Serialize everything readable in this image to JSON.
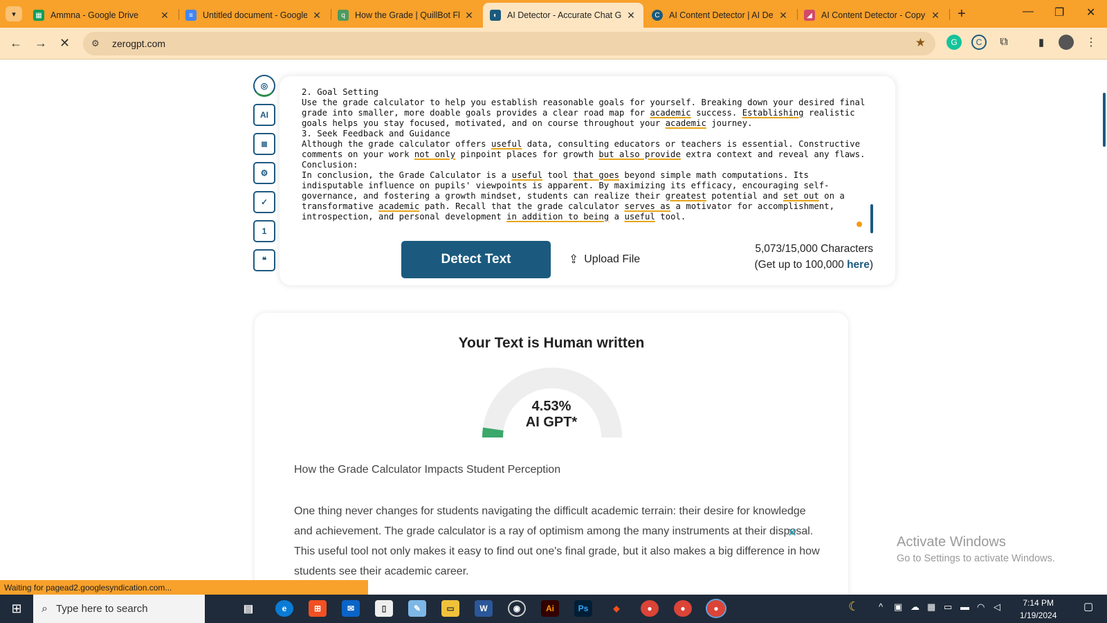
{
  "browser": {
    "tabs": [
      {
        "title": "Ammna - Google Drive",
        "icon": "sheets-icon",
        "color": "#0f9d58"
      },
      {
        "title": "Untitled document - Google",
        "icon": "docs-icon",
        "color": "#4285f4"
      },
      {
        "title": "How the Grade | QuillBot Flo",
        "icon": "quillbot-icon",
        "color": "#4c9a5f"
      },
      {
        "title": "AI Detector - Accurate Chat G",
        "icon": "zerogpt-icon",
        "color": "#1b5a7e"
      },
      {
        "title": "AI Content Detector | AI Dete",
        "icon": "copyleaks-icon",
        "color": "#1b5a7e"
      },
      {
        "title": "AI Content Detector - Copyle",
        "icon": "copyleaks-pink-icon",
        "color": "#d14a6a"
      }
    ],
    "url": "zerogpt.com",
    "status": "Waiting for pagead2.googlesyndication.com..."
  },
  "editor": {
    "lines": [
      "2. Goal Setting",
      "Use the grade calculator to help you establish reasonable goals for yourself. Breaking down your desired final",
      "grade into smaller, more doable goals provides a clear road map for academic success. Establishing realistic",
      "goals helps you stay focused, motivated, and on course throughout your academic journey.",
      "3. Seek Feedback and Guidance",
      "Although the grade calculator offers useful data, consulting educators or teachers is essential. Constructive",
      "comments on your work not only pinpoint places for growth but also provide extra context and reveal any flaws.",
      "Conclusion:",
      "In conclusion, the Grade Calculator is a useful tool that goes beyond simple math computations. Its",
      "indisputable influence on pupils' viewpoints is apparent. By maximizing its efficacy, encouraging self-",
      "governance, and fostering a growth mindset, students can realize their greatest potential and set out on a",
      "transformative academic path. Recall that the grade calculator serves as a motivator for accomplishment,",
      "introspection, and personal development in addition to being a useful tool."
    ],
    "underlined": [
      "Establishing",
      "academic",
      "useful",
      "not only",
      "but also provide",
      "that goes",
      "greatest",
      "set out",
      "serves as",
      "in addition to being"
    ],
    "detect_label": "Detect Text",
    "upload_label": "Upload File",
    "char_count": "5,073/15,000 Characters",
    "char_upsell_prefix": "(Get up to 100,000 ",
    "char_upsell_link": "here",
    "char_upsell_suffix": ")"
  },
  "result": {
    "heading": "Your Text is Human written",
    "percent": "4.53%",
    "percent_value": 4.53,
    "gauge_label": "AI GPT*",
    "gauge_fill_color": "#3aa86b",
    "gauge_track_color": "#eeeeee",
    "section_title": "How the Grade Calculator Impacts Student Perception",
    "paragraph": "One thing never changes for students navigating the difficult academic terrain: their desire for knowledge and achievement. The grade calculator is a ray of optimism among the many instruments at their disposal. This useful tool not only makes it easy to find out one's final grade, but it also makes a big difference in how students see their academic career."
  },
  "watermark": {
    "line1": "Activate Windows",
    "line2": "Go to Settings to activate Windows."
  },
  "taskbar": {
    "search_placeholder": "Type here to search",
    "time": "7:14 PM",
    "date": "1/19/2024"
  },
  "colors": {
    "tabbar": "#f8a12b",
    "accent": "#1b5a7e"
  }
}
